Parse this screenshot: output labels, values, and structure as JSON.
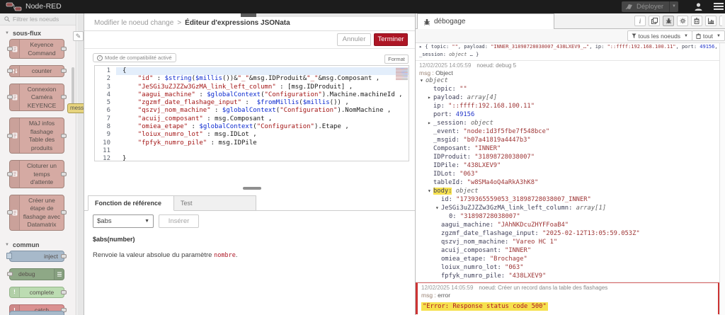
{
  "header": {
    "app_title": "Node-RED",
    "deploy_label": "Déployer"
  },
  "palette": {
    "search_placeholder": "Filtrer les noeuds",
    "sections": [
      {
        "label": "sous-flux",
        "nodes": [
          {
            "name": "keyence-command",
            "lines": [
              "Keyence",
              "Command"
            ],
            "color": "#d5aaa3",
            "border": "#a2837b",
            "icon": "doc",
            "ports": "both"
          },
          {
            "name": "counter",
            "lines": [
              "counter"
            ],
            "color": "#d5aaa3",
            "border": "#a2837b",
            "icon": "arrows",
            "ports": "both"
          },
          {
            "name": "connexion-camera-keyence",
            "lines": [
              "Connexion",
              "Caméra",
              "KEYENCE"
            ],
            "color": "#d5aaa3",
            "border": "#a2837b",
            "icon": "doc",
            "ports": "both"
          },
          {
            "name": "maj-infos-flashage",
            "lines": [
              "MàJ infos",
              "flashage",
              "Table des",
              "produits"
            ],
            "color": "#d5aaa3",
            "border": "#a2837b",
            "icon": "doc",
            "ports": "both"
          },
          {
            "name": "cloturer-un-temps-dattente",
            "lines": [
              "Cloturer un",
              "temps",
              "d'attente"
            ],
            "color": "#d5aaa3",
            "border": "#a2837b",
            "icon": "doc",
            "ports": "both"
          },
          {
            "name": "creer-une-etape-de-flashage",
            "lines": [
              "Créer une",
              "étape de",
              "flashage avec",
              "Datamatrix"
            ],
            "color": "#d5aaa3",
            "border": "#a2837b",
            "icon": "doc",
            "ports": "both"
          }
        ]
      },
      {
        "label": "commun",
        "nodes": [
          {
            "name": "inject",
            "lines": [
              "inject"
            ],
            "color": "#a7b9ca",
            "border": "#8193a5",
            "ports": "right",
            "button": "left",
            "align": "right"
          },
          {
            "name": "debug",
            "lines": [
              "debug"
            ],
            "color": "#8ea886",
            "border": "#71896a",
            "ports": "left",
            "iconRight": "menu",
            "align": "left"
          },
          {
            "name": "complete",
            "lines": [
              "complete"
            ],
            "color": "#bcdcb2",
            "border": "#93b489",
            "icon": "excl",
            "ports": "right"
          },
          {
            "name": "catch",
            "lines": [
              "catch"
            ],
            "color": "#da9191",
            "border": "#b06f6f",
            "icon": "excl",
            "ports": "right"
          },
          {
            "name": "status",
            "lines": [
              ""
            ],
            "color": "#a7b9ca",
            "border": "#8193a5",
            "ports": "right",
            "sliver": true
          }
        ]
      }
    ]
  },
  "canvas": {
    "node_fragment_label": "mess"
  },
  "editor_panel": {
    "breadcrumb": "Modifier le noeud change",
    "separator": ">",
    "title": "Éditeur d'expressions JSONata",
    "cancel_label": "Annuler",
    "done_label": "Terminer",
    "compat_badge": "Mode de compatibilité activé",
    "format_label": "Format",
    "code_lines": [
      [
        [
          "p",
          "{"
        ]
      ],
      [
        [
          "p",
          "    "
        ],
        [
          "s",
          "\"id\""
        ],
        [
          "p",
          " : "
        ],
        [
          "k",
          "$string"
        ],
        [
          "p",
          "("
        ],
        [
          "k",
          "$millis"
        ],
        [
          "p",
          "())&"
        ],
        [
          "s",
          "\"_\""
        ],
        [
          "p",
          "&msg.IDProduit&"
        ],
        [
          "s",
          "\"_\""
        ],
        [
          "p",
          "&msg.Composant ,"
        ]
      ],
      [
        [
          "p",
          "    "
        ],
        [
          "s",
          "\"JeSGi3uZJZZw3GzMA_link_left_column\""
        ],
        [
          "p",
          " : [msg.IDProduit] ,"
        ]
      ],
      [
        [
          "p",
          "    "
        ],
        [
          "s",
          "\"aagui_machine\""
        ],
        [
          "p",
          " : "
        ],
        [
          "k",
          "$globalContext"
        ],
        [
          "p",
          "("
        ],
        [
          "s",
          "\"Configuration\""
        ],
        [
          "p",
          ").Machine.machineId ,"
        ]
      ],
      [
        [
          "p",
          "    "
        ],
        [
          "s",
          "\"zgzmf_date_flashage_input\""
        ],
        [
          "p",
          " :  "
        ],
        [
          "k",
          "$fromMillis"
        ],
        [
          "p",
          "("
        ],
        [
          "k",
          "$millis"
        ],
        [
          "p",
          "()) ,"
        ]
      ],
      [
        [
          "p",
          "    "
        ],
        [
          "s",
          "\"qszvj_nom_machine\""
        ],
        [
          "p",
          " : "
        ],
        [
          "k",
          "$globalContext"
        ],
        [
          "p",
          "("
        ],
        [
          "s",
          "\"Configuration\""
        ],
        [
          "p",
          ").NomMachine ,"
        ]
      ],
      [
        [
          "p",
          "    "
        ],
        [
          "s",
          "\"acuij_composant\""
        ],
        [
          "p",
          " : msg.Composant ,"
        ]
      ],
      [
        [
          "p",
          "    "
        ],
        [
          "s",
          "\"omiea_etape\""
        ],
        [
          "p",
          " : "
        ],
        [
          "k",
          "$globalContext"
        ],
        [
          "p",
          "("
        ],
        [
          "s",
          "\"Configuration\""
        ],
        [
          "p",
          ").Etape ,"
        ]
      ],
      [
        [
          "p",
          "    "
        ],
        [
          "s",
          "\"loiux_numro_lot\""
        ],
        [
          "p",
          " : msg.IDLot ,"
        ]
      ],
      [
        [
          "p",
          "    "
        ],
        [
          "s",
          "\"fpfyk_numro_pile\""
        ],
        [
          "p",
          " : msg.IDPile"
        ]
      ],
      [],
      [
        [
          "p",
          "}"
        ]
      ]
    ],
    "tabs": [
      "Fonction de référence",
      "Test"
    ],
    "function_select_value": "$abs",
    "insert_label": "Insérer",
    "signature": "$abs(number)",
    "description_prefix": "Renvoie la valeur absolue du paramètre ",
    "description_code": "nombre",
    "description_suffix": "."
  },
  "debug": {
    "tab_label": "débogage",
    "filter_nodes_label": "tous les noeuds",
    "clear_label": "tout",
    "messages": [
      {
        "type": "preview",
        "line1": [
          [
            "p",
            "▸ { "
          ],
          [
            "k",
            "topic"
          ],
          [
            "p",
            ": "
          ],
          [
            "s",
            "\"\""
          ],
          [
            "p",
            ", "
          ],
          [
            "k",
            "payload"
          ],
          [
            "p",
            ": "
          ],
          [
            "s",
            "\"INNER_31898728038007_438LXEV9_…\""
          ],
          [
            "p",
            ", "
          ],
          [
            "k",
            "ip"
          ],
          [
            "p",
            ": "
          ],
          [
            "s",
            "\"::ffff:192.168.100.11\""
          ],
          [
            "p",
            ", "
          ],
          [
            "k",
            "port"
          ],
          [
            "p",
            ": "
          ],
          [
            "n",
            "49156"
          ],
          [
            "p",
            ","
          ]
        ],
        "line2": [
          [
            "k",
            "_session"
          ],
          [
            "p",
            ": "
          ],
          [
            "o",
            "object"
          ],
          [
            "p",
            " … }"
          ]
        ]
      },
      {
        "type": "object",
        "meta_date": "12/02/2025 14:05:59",
        "meta_node": "noeud: debug 5",
        "path": "msg",
        "path_type": "Object",
        "rows": [
          {
            "i": 0,
            "a": "v",
            "k": "object",
            "ko": true
          },
          {
            "i": 1,
            "k": "topic",
            "v": "\"\"",
            "vc": "vs"
          },
          {
            "i": 1,
            "a": "c",
            "k": "payload",
            "v": "array[4]",
            "vc": "vo"
          },
          {
            "i": 1,
            "k": "ip",
            "v": "\"::ffff:192.168.100.11\"",
            "vc": "vs"
          },
          {
            "i": 1,
            "k": "port",
            "v": "49156",
            "vc": "vn"
          },
          {
            "i": 1,
            "a": "c",
            "k": "_session",
            "v": "object",
            "vc": "vo"
          },
          {
            "i": 1,
            "k": "_event",
            "v": "\"node:1d3f5fbe7f548bce\"",
            "vc": "vs"
          },
          {
            "i": 1,
            "k": "_msgid",
            "v": "\"b07a41819a4447b3\"",
            "vc": "vs"
          },
          {
            "i": 1,
            "k": "Composant",
            "v": "\"INNER\"",
            "vc": "vs"
          },
          {
            "i": 1,
            "k": "IDProduit",
            "v": "\"31898728038007\"",
            "vc": "vs"
          },
          {
            "i": 1,
            "k": "IDPile",
            "v": "\"438LXEV9\"",
            "vc": "vs"
          },
          {
            "i": 1,
            "k": "IDLot",
            "v": "\"063\"",
            "vc": "vs"
          },
          {
            "i": 1,
            "k": "tableId",
            "v": "\"w8SMa4oQ4aRkA3hK8\"",
            "vc": "vs"
          },
          {
            "i": 1,
            "a": "v",
            "k": "body",
            "v": "object",
            "vc": "vo",
            "hl": true
          },
          {
            "i": 2,
            "k": "id",
            "v": "\"1739365559053_31898728038007_INNER\"",
            "vc": "vs"
          },
          {
            "i": 2,
            "a": "v",
            "k": "JeSGi3uZJZZw3GzMA_link_left_column",
            "v": "array[1]",
            "vc": "vo"
          },
          {
            "i": 3,
            "k": "0",
            "v": "\"31898728038007\"",
            "vc": "vs"
          },
          {
            "i": 2,
            "k": "aagui_machine",
            "v": "\"JAhNKDcuZHYFFoaB4\"",
            "vc": "vs"
          },
          {
            "i": 2,
            "k": "zgzmf_date_flashage_input",
            "v": "\"2025-02-12T13:05:59.053Z\"",
            "vc": "vs"
          },
          {
            "i": 2,
            "k": "qszvj_nom_machine",
            "v": "\"Vareo HC 1\"",
            "vc": "vs"
          },
          {
            "i": 2,
            "k": "acuij_composant",
            "v": "\"INNER\"",
            "vc": "vs"
          },
          {
            "i": 2,
            "k": "omiea_etape",
            "v": "\"Brochage\"",
            "vc": "vs"
          },
          {
            "i": 2,
            "k": "loiux_numro_lot",
            "v": "\"063\"",
            "vc": "vs"
          },
          {
            "i": 2,
            "k": "fpfyk_numro_pile",
            "v": "\"438LXEV9\"",
            "vc": "vs"
          }
        ]
      },
      {
        "type": "error",
        "meta_date": "12/02/2025 14:05:59",
        "meta_node": "noeud: Créer un record dans la table des flashages",
        "path": "msg",
        "path_type": "error",
        "text": "\"Error: Response status code 500\""
      }
    ]
  },
  "colors": {
    "accent_red": "#ad1625",
    "highlight_yellow": "#f6e14e",
    "header_bg": "#1c1c1c"
  }
}
